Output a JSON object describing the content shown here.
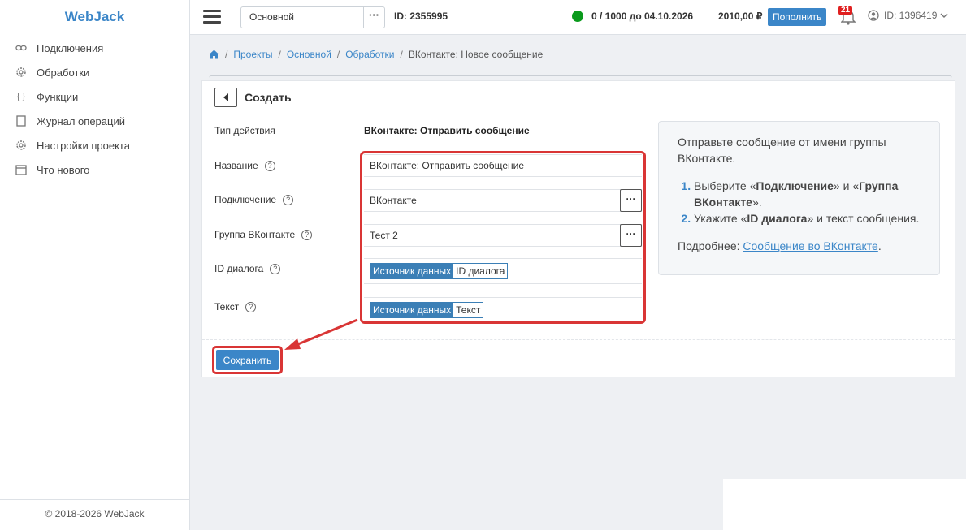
{
  "app": {
    "logo": "WebJack",
    "footer": "© 2018-2026 WebJack"
  },
  "sidebar": {
    "items": [
      {
        "label": "Подключения",
        "icon": "link-icon"
      },
      {
        "label": "Обработки",
        "icon": "gear-icon"
      },
      {
        "label": "Функции",
        "icon": "braces-icon"
      },
      {
        "label": "Журнал операций",
        "icon": "journal-icon"
      },
      {
        "label": "Настройки проекта",
        "icon": "settings-icon"
      },
      {
        "label": "Что нового",
        "icon": "calendar-icon"
      }
    ]
  },
  "header": {
    "project": "Основной",
    "project_dots": "···",
    "project_id": "ID: 2355995",
    "usage": "0 / 1000 до 04.10.2026",
    "balance": "2010,00 ₽",
    "topup_label": "Пополнить",
    "notifications": "21",
    "user_id": "ID: 1396419",
    "status_color": "#0a9a1c"
  },
  "breadcrumb": {
    "items": [
      "Проекты",
      "Основной",
      "Обработки"
    ],
    "current": "ВКонтакте: Новое сообщение"
  },
  "form": {
    "title": "Создать",
    "action_type_label": "Тип действия",
    "action_type_value": "ВКонтакте: Отправить сообщение",
    "name_label": "Название",
    "name_value": "ВКонтакте: Отправить сообщение",
    "connection_label": "Подключение",
    "connection_value": "ВКонтакте",
    "group_label": "Группа ВКонтакте",
    "group_value": "Тест 2",
    "dialog_label": "ID диалога",
    "dialog_tag_source": "Источник данных",
    "dialog_tag_value": "ID диалога",
    "text_label": "Текст",
    "text_tag_source": "Источник данных",
    "text_tag_value": "Текст",
    "dots": "···",
    "help": "?",
    "save_label": "Сохранить"
  },
  "info": {
    "intro": "Отправьте сообщение от имени группы ВКонтакте.",
    "step1_pre": "Выберите «",
    "step1_b1": "Подключение",
    "step1_mid": "» и «",
    "step1_b2": "Группа ВКонтакте",
    "step1_post": "».",
    "step2_pre": "Укажите «",
    "step2_b": "ID диалога",
    "step2_post": "» и текст сообщения.",
    "more_label": "Подробнее:",
    "more_link": "Сообщение во ВКонтакте",
    "more_end": "."
  },
  "colors": {
    "accent": "#3b86c8",
    "highlight": "#d93535",
    "tag": "#3b7fb6"
  }
}
